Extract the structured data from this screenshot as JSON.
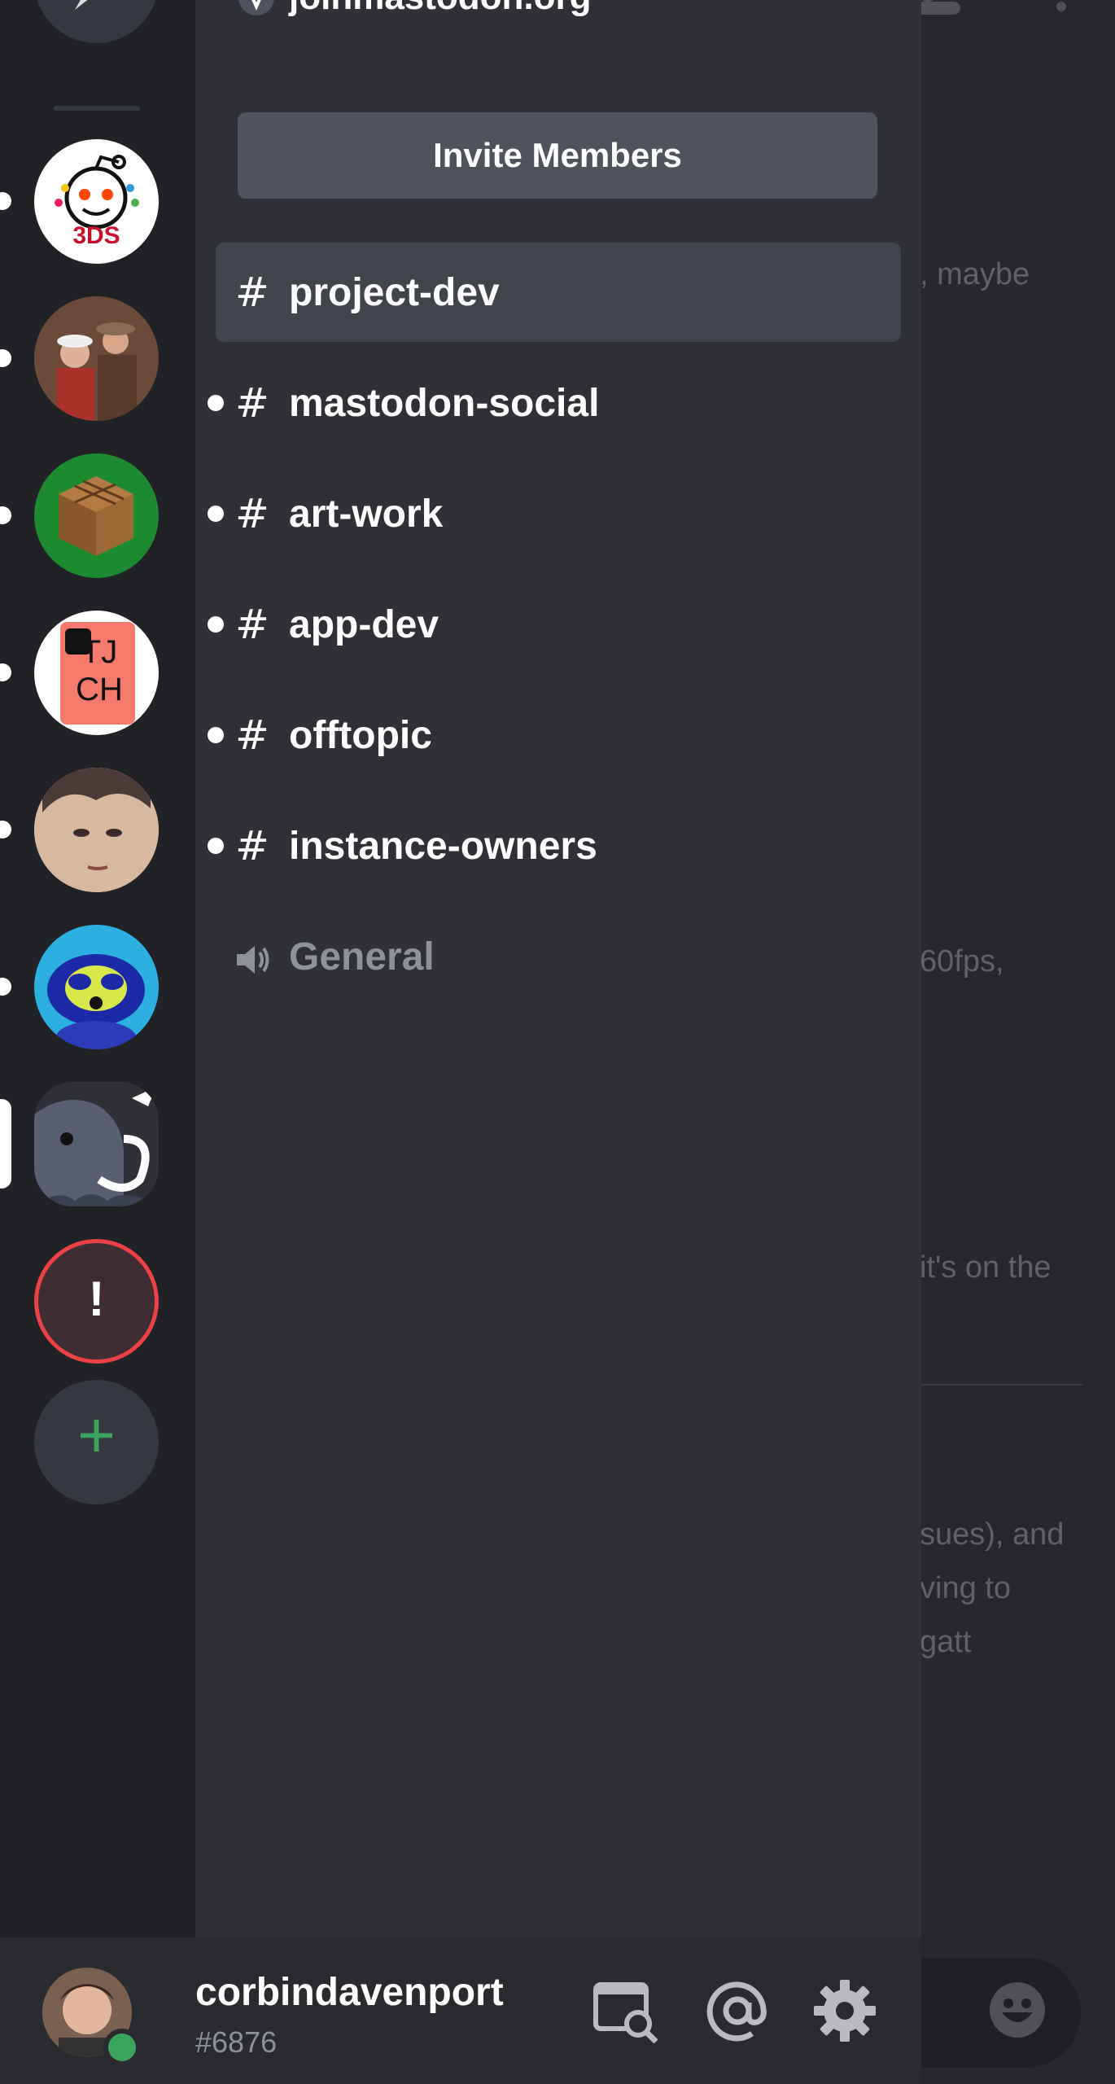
{
  "server": {
    "name": "joinmastodon.org",
    "invite_label": "Invite Members"
  },
  "channels": [
    {
      "name": "project-dev",
      "type": "text",
      "active": true,
      "unread": false
    },
    {
      "name": "mastodon-social",
      "type": "text",
      "active": false,
      "unread": true
    },
    {
      "name": "art-work",
      "type": "text",
      "active": false,
      "unread": true
    },
    {
      "name": "app-dev",
      "type": "text",
      "active": false,
      "unread": true
    },
    {
      "name": "offtopic",
      "type": "text",
      "active": false,
      "unread": true
    },
    {
      "name": "instance-owners",
      "type": "text",
      "active": false,
      "unread": true
    },
    {
      "name": "General",
      "type": "voice",
      "active": false,
      "unread": false
    }
  ],
  "servers": [
    {
      "name": "r/3DS",
      "icon": "reddit-3ds-icon",
      "text": "3DS"
    },
    {
      "name": "movie-scene",
      "icon": "couple-photo-icon"
    },
    {
      "name": "crafting-table",
      "icon": "crafting-table-icon"
    },
    {
      "name": "TJCH",
      "icon": "tjch-icon",
      "text": "TJ CH"
    },
    {
      "name": "face",
      "icon": "face-photo-icon"
    },
    {
      "name": "raccoon",
      "icon": "raccoon-icon"
    },
    {
      "name": "mastodon",
      "icon": "mastodon-icon",
      "active": true
    },
    {
      "name": "alert",
      "icon": "alert-icon",
      "text": "!"
    },
    {
      "name": "add",
      "icon": "plus-icon",
      "text": "+"
    }
  ],
  "chat_fragments": [
    ", maybe",
    "60fps,",
    "it's on the",
    "sues), and",
    "ving to",
    "gatt"
  ],
  "user": {
    "username": "corbindavenport",
    "discriminator": "#6876",
    "status": "online"
  },
  "colors": {
    "rail": "#202225",
    "panel": "#2f3136",
    "active_channel": "#40444b",
    "online": "#3ba55d",
    "add_green": "#3ba55d",
    "alert_red": "#ed4245"
  }
}
